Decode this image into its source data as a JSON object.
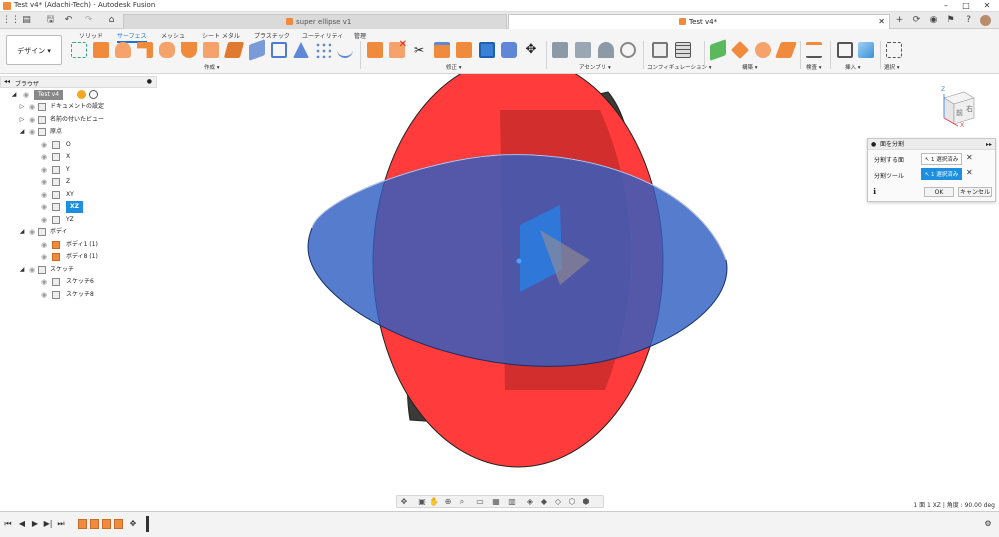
{
  "window": {
    "title": "Test v4* (Adachi-Tech) - Autodesk Fusion"
  },
  "tabs": [
    {
      "label": "super ellipse v1",
      "active": false
    },
    {
      "label": "Test v4*",
      "active": true
    }
  ],
  "ribbon": {
    "workspace_label": "デザイン ▾",
    "tabs": [
      "ソリッド",
      "サーフェス",
      "メッシュ",
      "シート メタル",
      "プラスチック",
      "ユーティリティ",
      "管理"
    ],
    "active_tab": "サーフェス",
    "groups": [
      "作成 ▾",
      "修正 ▾",
      "アセンブリ ▾",
      "コンフィギュレーション ▾",
      "構築 ▾",
      "検査 ▾",
      "挿入 ▾",
      "選択 ▾"
    ]
  },
  "browser": {
    "title": "ブラウザ",
    "root": "Test v4",
    "items": [
      {
        "label": "ドキュメントの設定",
        "indent": 1
      },
      {
        "label": "名前の付いたビュー",
        "indent": 1
      },
      {
        "label": "原点",
        "indent": 1
      },
      {
        "label": "O",
        "indent": 2
      },
      {
        "label": "X",
        "indent": 2
      },
      {
        "label": "Y",
        "indent": 2
      },
      {
        "label": "Z",
        "indent": 2
      },
      {
        "label": "XY",
        "indent": 2
      },
      {
        "label": "XZ",
        "indent": 2,
        "selected": true
      },
      {
        "label": "YZ",
        "indent": 2
      },
      {
        "label": "ボディ",
        "indent": 1
      },
      {
        "label": "ボディ1 (1)",
        "indent": 2
      },
      {
        "label": "ボディ8 (1)",
        "indent": 2
      },
      {
        "label": "スケッチ",
        "indent": 1
      },
      {
        "label": "スケッチ6",
        "indent": 2
      },
      {
        "label": "スケッチ8",
        "indent": 2
      }
    ]
  },
  "split_face_dialog": {
    "title": "面を分割",
    "rows": [
      {
        "label": "分割する面",
        "value": "1 選択済み",
        "highlighted": false
      },
      {
        "label": "分割ツール",
        "value": "1 選択済み",
        "highlighted": true
      }
    ],
    "ok": "OK",
    "cancel": "キャンセル"
  },
  "status": {
    "text": "1 面 1 XZ | 角度 : 90.00 deg"
  },
  "viewcube": {
    "front": "前",
    "right": "右",
    "axis_z": "Z",
    "axis_x": "X"
  },
  "colors": {
    "accent": "#1d8fe0",
    "red_surface": "#ff3b3b",
    "blue_surface": "#2f5fc2",
    "dark_surface": "#3a3a38"
  }
}
